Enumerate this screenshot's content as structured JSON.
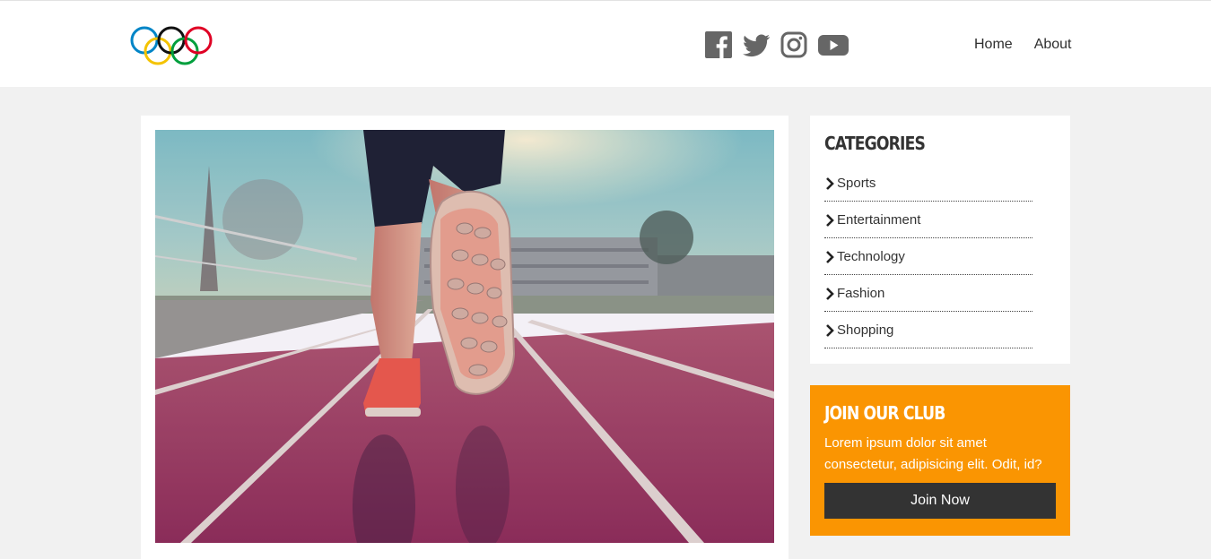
{
  "header": {
    "logo": "olympic-rings-logo",
    "social": [
      {
        "name": "facebook-icon"
      },
      {
        "name": "twitter-icon"
      },
      {
        "name": "instagram-icon"
      },
      {
        "name": "youtube-icon"
      }
    ],
    "nav": {
      "home": "Home",
      "about": "About"
    }
  },
  "post": {
    "image": "runner-on-track-photo"
  },
  "sidebar": {
    "categories": {
      "title": "CATEGORIES",
      "items": [
        "Sports",
        "Entertainment",
        "Technology",
        "Fashion",
        "Shopping"
      ]
    },
    "club": {
      "title": "JOIN OUR CLUB",
      "text": "Lorem ipsum dolor sit amet consectetur, adipisicing elit. Odit, id?",
      "button": "Join Now"
    }
  },
  "colors": {
    "page_bg": "#f1f1f1",
    "club_bg": "#fa9502",
    "button_bg": "#333333",
    "ring_blue": "#0085c7",
    "ring_yellow": "#f4c300",
    "ring_black": "#000000",
    "ring_green": "#009f3d",
    "ring_red": "#df0024"
  }
}
